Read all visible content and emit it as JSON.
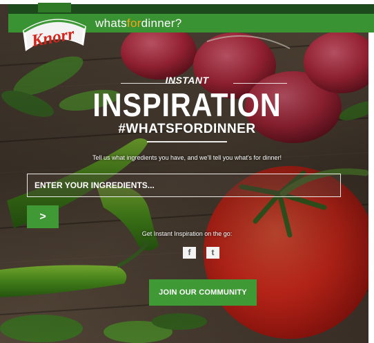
{
  "header": {
    "tagline_pre": "whats",
    "tagline_hl": "for",
    "tagline_post": "dinner?",
    "logo_text": "Knorr"
  },
  "hero": {
    "kicker": "INSTANT",
    "title": "INSPIRATION",
    "hashtag": "#WHATSFORDINNER",
    "subtext": "Tell us what ingredients you have, and we'll tell you what's for dinner!"
  },
  "search": {
    "placeholder": "ENTER YOUR INGREDIENTS...",
    "value": ""
  },
  "go_button": {
    "icon": "chevron-right-icon",
    "glyph": ">"
  },
  "social": {
    "text": "Get Instant Inspiration on the go:",
    "facebook_glyph": "f",
    "twitter_glyph": "t",
    "icons": [
      "facebook-icon",
      "twitter-icon"
    ]
  },
  "cta": {
    "label": "JOIN OUR COMMUNITY"
  },
  "colors": {
    "brand_green": "#3f9a36",
    "dark_green": "#1c4a1c",
    "accent_orange": "#f5a219",
    "logo_red": "#d4261c"
  }
}
